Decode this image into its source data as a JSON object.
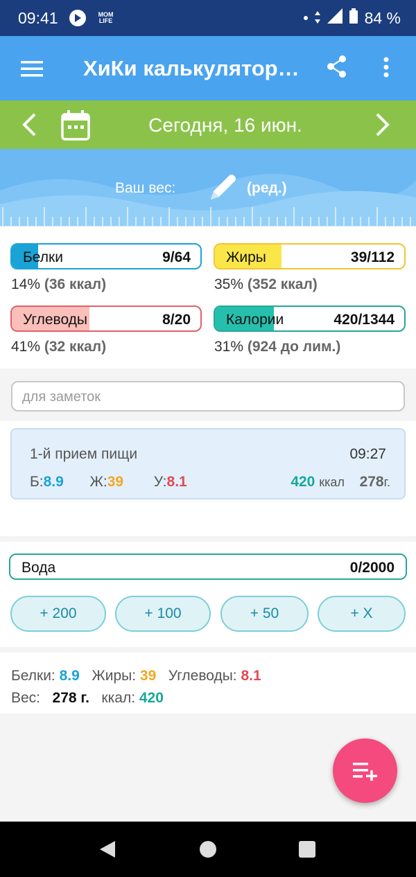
{
  "status_bar": {
    "time": "09:41",
    "app_badge": "MOM LIFE",
    "battery": "84 %"
  },
  "app_bar": {
    "title": "ХиКи калькулятор…",
    "icons": [
      "menu-icon",
      "share-icon",
      "more-vert-icon"
    ]
  },
  "date_bar": {
    "date": "Сегодня, 16 июн."
  },
  "weight": {
    "label": "Ваш вес:",
    "edit": "(ред.)"
  },
  "macros": {
    "protein": {
      "name": "Белки",
      "value": "9/64",
      "pct": "14%",
      "kcal": "(36 ккал)",
      "fill": 0.14,
      "color": "#1aa3d6"
    },
    "fat": {
      "name": "Жиры",
      "value": "39/112",
      "pct": "35%",
      "kcal": "(352 ккал)",
      "fill": 0.35,
      "color": "#fbe64a"
    },
    "carbs": {
      "name": "Углеводы",
      "value": "8/20",
      "pct": "41%",
      "kcal": "(32 ккал)",
      "fill": 0.41,
      "color": "#fbbfba"
    },
    "calories": {
      "name": "Калории",
      "value": "420/1344",
      "pct": "31%",
      "kcal": "(924 до лим.)",
      "fill": 0.31,
      "color": "#26bfae"
    }
  },
  "notes": {
    "placeholder": "для заметок"
  },
  "meal": {
    "name": "1-й прием пищи",
    "time": "09:27",
    "protein_label": "Б:",
    "protein": "8.9",
    "fat_label": "Ж:",
    "fat": "39",
    "carbs_label": "У:",
    "carbs": "8.1",
    "kcal": "420",
    "kcal_unit": "ккал",
    "weight": "278",
    "weight_unit": "г."
  },
  "water": {
    "name": "Вода",
    "value": "0/2000",
    "buttons": [
      "+ 200",
      "+ 100",
      "+ 50",
      "+ X"
    ]
  },
  "summary": {
    "protein_label": "Белки:",
    "protein": "8.9",
    "fat_label": "Жиры:",
    "fat": "39",
    "carbs_label": "Углеводы:",
    "carbs": "8.1",
    "weight_label": "Вес:",
    "weight": "278 г.",
    "kcal_label": "ккал:",
    "kcal": "420"
  },
  "colors": {
    "appbar": "#4aa3ee",
    "datebar": "#8bc34a",
    "fab": "#f44a7e",
    "statusbar": "#1b3d7d"
  }
}
